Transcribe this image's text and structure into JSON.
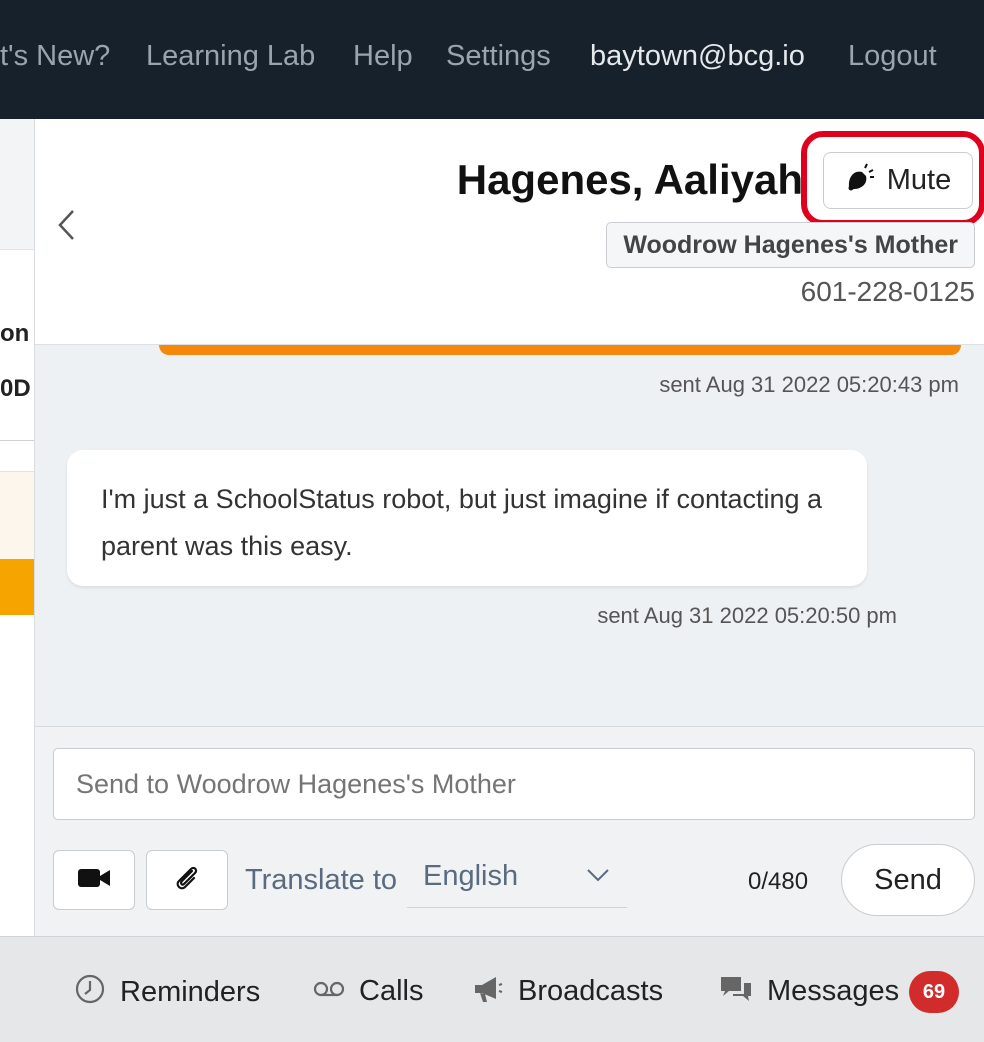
{
  "topnav": {
    "items": [
      "t's New?",
      "Learning Lab",
      "Help",
      "Settings"
    ],
    "user_email": "baytown@bcg.io",
    "logout": "Logout"
  },
  "background": {
    "text_1": "on",
    "text_2": "0D"
  },
  "conversation": {
    "contact_name": "Hagenes, Aaliyah",
    "mute_label": "Mute",
    "relation": "Woodrow Hagenes's Mother",
    "phone": "601-228-0125",
    "messages": [
      {
        "text": "",
        "timestamp": "sent Aug 31 2022 05:20:43 pm",
        "direction": "outgoing"
      },
      {
        "text": "I'm just a SchoolStatus robot, but just imagine if contacting a parent was this easy.",
        "timestamp": "sent Aug 31 2022 05:20:50 pm",
        "direction": "incoming"
      }
    ]
  },
  "composer": {
    "placeholder": "Send to Woodrow Hagenes's Mother",
    "translate_label": "Translate to",
    "language": "English",
    "char_count": "0/480",
    "send_label": "Send"
  },
  "bottom_bar": {
    "tabs": [
      {
        "label": "Reminders",
        "icon": "clock-icon"
      },
      {
        "label": "Calls",
        "icon": "voicemail-icon"
      },
      {
        "label": "Broadcasts",
        "icon": "megaphone-icon"
      },
      {
        "label": "Messages",
        "icon": "chat-bubbles-icon"
      }
    ],
    "messages_badge": "69"
  },
  "colors": {
    "nav_bg": "#17212b",
    "highlight": "#e0001b",
    "outgoing_bubble": "#f5880a",
    "badge": "#d22b2b"
  }
}
